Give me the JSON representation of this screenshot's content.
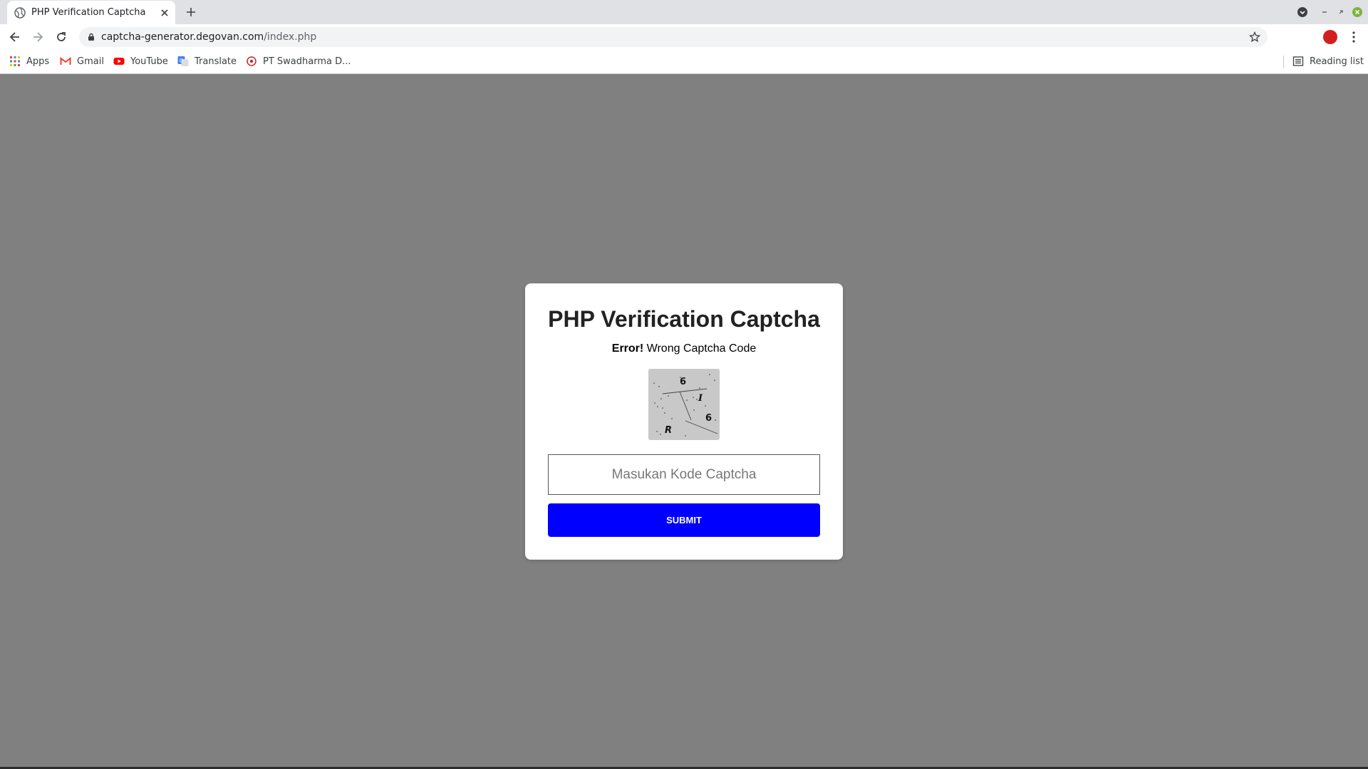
{
  "browser": {
    "tab": {
      "title": "PHP Verification Captcha",
      "favicon": "globe-icon"
    },
    "address": {
      "domain": "captcha-generator.degovan.com",
      "path": "/index.php"
    },
    "bookmarks": [
      {
        "label": "Apps",
        "icon": "apps-grid-icon"
      },
      {
        "label": "Gmail",
        "icon": "gmail-icon"
      },
      {
        "label": "YouTube",
        "icon": "youtube-icon"
      },
      {
        "label": "Translate",
        "icon": "translate-icon"
      },
      {
        "label": "PT Swadharma D...",
        "icon": "site-favicon-icon"
      }
    ],
    "reading_list": "Reading list"
  },
  "page": {
    "title": "PHP Verification Captcha",
    "error_label": "Error!",
    "error_text": " Wrong Captcha Code",
    "captcha_chars": [
      "6",
      "I",
      "6",
      "R"
    ],
    "input_placeholder": "Masukan Kode Captcha",
    "submit_label": "SUBMIT"
  },
  "colors": {
    "page_background": "#808080",
    "submit_button": "#0000ff"
  }
}
